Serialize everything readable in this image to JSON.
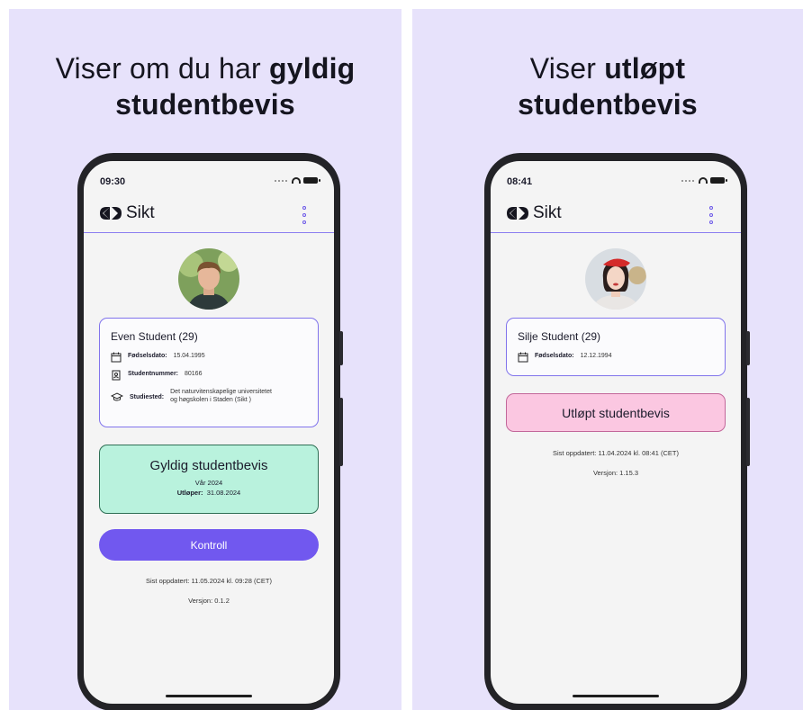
{
  "left": {
    "headline_light": "Viser om du har ",
    "headline_bold": "gyldig",
    "headline_line2": "studentbevis",
    "time": "09:30",
    "app_name": "Sikt",
    "student_name": "Even Student (29)",
    "birth_label": "Fødselsdato:",
    "birth_value": "15.04.1995",
    "number_label": "Studentnummer:",
    "number_value": "80166",
    "place_label": "Studiested:",
    "place_value": "Det naturvitenskapelige universitetet og høgskolen i Staden (Sikt )",
    "status_title": "Gyldig studentbevis",
    "semester": "Vår 2024",
    "expires_label": "Utløper:",
    "expires_value": "31.08.2024",
    "button_label": "Kontroll",
    "updated": "Sist oppdatert: 11.05.2024 kl. 09:28 (CET)",
    "version": "Versjon: 0.1.2"
  },
  "right": {
    "headline_light": "Viser ",
    "headline_bold": "utløpt",
    "headline_line2": "studentbevis",
    "time": "08:41",
    "app_name": "Sikt",
    "student_name": "Silje Student (29)",
    "birth_label": "Fødselsdato:",
    "birth_value": "12.12.1994",
    "status_title": "Utløpt studentbevis",
    "updated": "Sist oppdatert: 11.04.2024 kl. 08:41 (CET)",
    "version": "Versjon: 1.15.3"
  },
  "colors": {
    "background": "#e7e2fb",
    "accent": "#7158ef",
    "valid_fill": "#b9f2dd",
    "expired_fill": "#fbc7e1"
  }
}
